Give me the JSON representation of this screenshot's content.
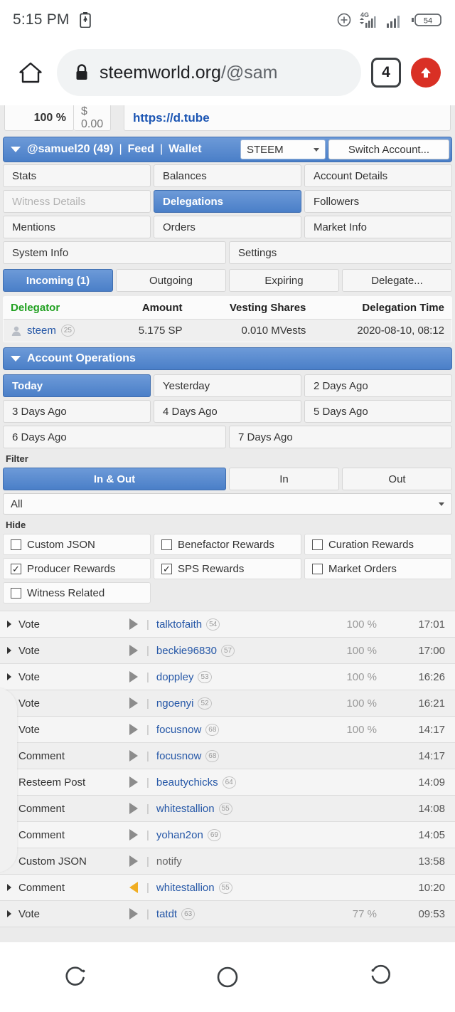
{
  "status_bar": {
    "time": "5:15 PM",
    "battery_percent": "54",
    "network_type": "4G",
    "icons": [
      "battery-charging-icon",
      "cast-icon",
      "signal-4g-icon",
      "signal-bars-icon",
      "battery-level-icon"
    ]
  },
  "browser": {
    "home_icon": "home-icon",
    "lock_icon": "lock-icon",
    "url_bold": "steemworld.org",
    "url_dim": "/@sam",
    "tab_count": "4",
    "menu_icon": "up-arrow-icon"
  },
  "cut_strip": {
    "percent": "100 %",
    "value": "$ 0.00",
    "link": "https://d.tube"
  },
  "account_bar": {
    "account": "@samuel20 (49)",
    "sep1": "|",
    "feed": "Feed",
    "sep2": "|",
    "wallet": "Wallet",
    "chain_selected": "STEEM",
    "switch_account": "Switch Account..."
  },
  "nav_tabs": [
    {
      "label": "Stats",
      "active": false,
      "disabled": false
    },
    {
      "label": "Balances",
      "active": false,
      "disabled": false
    },
    {
      "label": "Account Details",
      "active": false,
      "disabled": false
    },
    {
      "label": "Witness Details",
      "active": false,
      "disabled": true
    },
    {
      "label": "Delegations",
      "active": true,
      "disabled": false
    },
    {
      "label": "Followers",
      "active": false,
      "disabled": false
    },
    {
      "label": "Mentions",
      "active": false,
      "disabled": false
    },
    {
      "label": "Orders",
      "active": false,
      "disabled": false
    },
    {
      "label": "Market Info",
      "active": false,
      "disabled": false
    }
  ],
  "nav_tabs_row4": [
    {
      "label": "System Info",
      "active": false
    },
    {
      "label": "Settings",
      "active": false
    }
  ],
  "delegation_tabs": [
    {
      "label": "Incoming (1)",
      "active": true
    },
    {
      "label": "Outgoing",
      "active": false
    },
    {
      "label": "Expiring",
      "active": false
    },
    {
      "label": "Delegate...",
      "active": false
    }
  ],
  "delegation_table": {
    "headers": [
      "Delegator",
      "Amount",
      "Vesting Shares",
      "Delegation Time"
    ],
    "rows": [
      {
        "delegator": "steem",
        "reputation": "25",
        "amount": "5.175 SP",
        "vesting_shares": "0.010 MVests",
        "delegation_time": "2020-08-10, 08:12"
      }
    ]
  },
  "account_operations": {
    "title": "Account Operations",
    "day_tabs": [
      {
        "label": "Today",
        "active": true
      },
      {
        "label": "Yesterday",
        "active": false
      },
      {
        "label": "2 Days Ago",
        "active": false
      },
      {
        "label": "3 Days Ago",
        "active": false
      },
      {
        "label": "4 Days Ago",
        "active": false
      },
      {
        "label": "5 Days Ago",
        "active": false
      }
    ],
    "day_tabs_row3": [
      {
        "label": "6 Days Ago",
        "active": false
      },
      {
        "label": "7 Days Ago",
        "active": false
      }
    ],
    "filter_label": "Filter",
    "direction_tabs": [
      {
        "label": "In & Out",
        "active": true
      },
      {
        "label": "In",
        "active": false
      },
      {
        "label": "Out",
        "active": false
      }
    ],
    "type_select_value": "All",
    "hide_label": "Hide",
    "hide_options": [
      {
        "label": "Custom JSON",
        "checked": false
      },
      {
        "label": "Benefactor Rewards",
        "checked": false
      },
      {
        "label": "Curation Rewards",
        "checked": false
      },
      {
        "label": "Producer Rewards",
        "checked": true
      },
      {
        "label": "SPS Rewards",
        "checked": true
      },
      {
        "label": "Market Orders",
        "checked": false
      },
      {
        "label": "Witness Related",
        "checked": false
      }
    ]
  },
  "operations": [
    {
      "type": "Vote",
      "direction": "out",
      "user": "talktofaith",
      "reputation": "54",
      "percent": "100 %",
      "time": "17:01"
    },
    {
      "type": "Vote",
      "direction": "out",
      "user": "beckie96830",
      "reputation": "57",
      "percent": "100 %",
      "time": "17:00"
    },
    {
      "type": "Vote",
      "direction": "out",
      "user": "doppley",
      "reputation": "53",
      "percent": "100 %",
      "time": "16:26"
    },
    {
      "type": "Vote",
      "direction": "out",
      "user": "ngoenyi",
      "reputation": "52",
      "percent": "100 %",
      "time": "16:21"
    },
    {
      "type": "Vote",
      "direction": "out",
      "user": "focusnow",
      "reputation": "68",
      "percent": "100 %",
      "time": "14:17"
    },
    {
      "type": "Comment",
      "direction": "out",
      "user": "focusnow",
      "reputation": "68",
      "percent": "",
      "time": "14:17"
    },
    {
      "type": "Resteem Post",
      "direction": "out",
      "user": "beautychicks",
      "reputation": "64",
      "percent": "",
      "time": "14:09"
    },
    {
      "type": "Comment",
      "direction": "out",
      "user": "whitestallion",
      "reputation": "55",
      "percent": "",
      "time": "14:08"
    },
    {
      "type": "Comment",
      "direction": "out",
      "user": "yohan2on",
      "reputation": "69",
      "percent": "",
      "time": "14:05"
    },
    {
      "type": "Custom JSON",
      "direction": "out",
      "user": "notify",
      "reputation": "",
      "percent": "",
      "time": "13:58"
    },
    {
      "type": "Comment",
      "direction": "in",
      "user": "whitestallion",
      "reputation": "55",
      "percent": "",
      "time": "10:20"
    },
    {
      "type": "Vote",
      "direction": "out",
      "user": "tatdt",
      "reputation": "63",
      "percent": "77 %",
      "time": "09:53"
    }
  ],
  "nav_bar": {
    "recents_icon": "recents-icon",
    "home_icon": "home-circle-icon",
    "back_icon": "back-icon"
  },
  "colors": {
    "accent_blue": "#4a7fc8",
    "link_blue": "#2557a7",
    "green_header": "#20a020",
    "orange_incoming": "#f0ad22",
    "menu_red": "#d93025"
  }
}
